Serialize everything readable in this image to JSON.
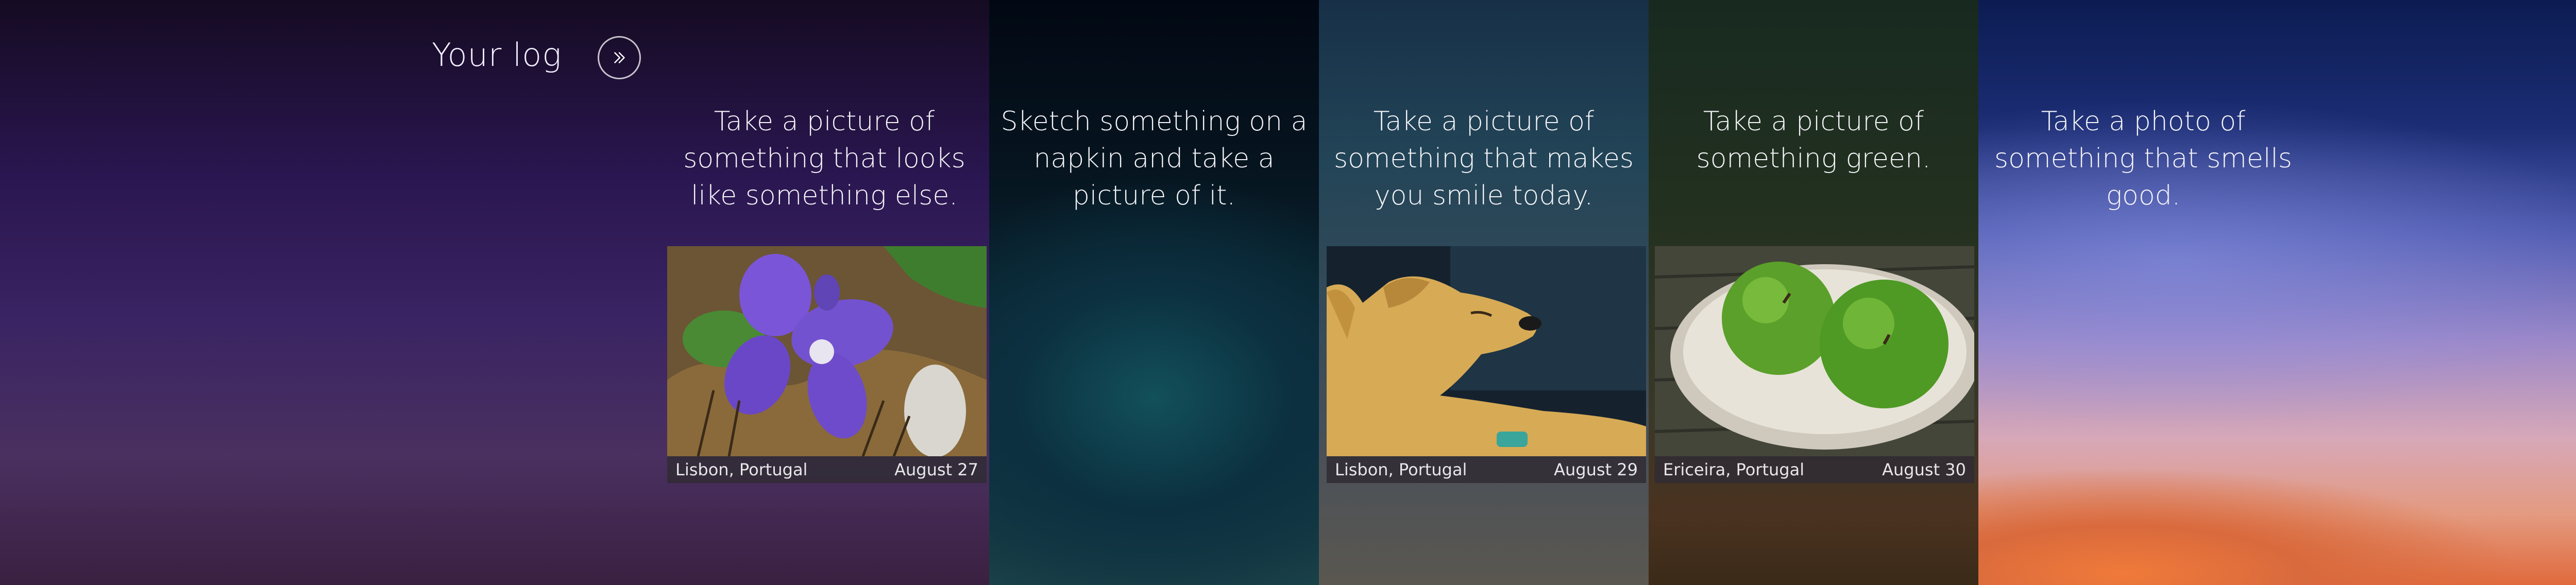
{
  "header": {
    "title": "Your log",
    "next_icon": "double-chevron-right-icon"
  },
  "entries": [
    {
      "prompt": "Take a picture of something that looks like something else.",
      "photo": "violet-flower",
      "location": "Lisbon, Portugal",
      "date": "August 27"
    },
    {
      "prompt": "Sketch something on a napkin and take a picture of it."
    },
    {
      "prompt": "Take a picture of something that makes you smile today.",
      "photo": "sleeping-dog",
      "location": "Lisbon, Portugal",
      "date": "August 29"
    },
    {
      "prompt": "Take a picture of something green.",
      "photo": "green-apples-bowl",
      "location": "Ericeira, Portugal",
      "date": "August 30"
    },
    {
      "prompt": "Take a photo of something that smells good."
    }
  ]
}
